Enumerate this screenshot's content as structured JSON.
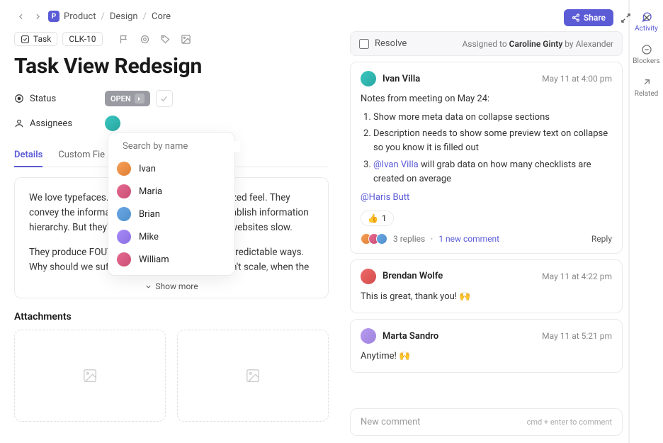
{
  "header": {
    "product_icon_letter": "P",
    "crumbs": [
      "Product",
      "Design",
      "Core"
    ],
    "share_label": "Share"
  },
  "task": {
    "type_label": "Task",
    "id": "CLK-10",
    "title": "Task View Redesign",
    "status_label": "Status",
    "status_value": "OPEN",
    "assignees_label": "Assignees"
  },
  "tabs": [
    "Details",
    "Custom Fie"
  ],
  "description": {
    "p1": "We love typefaces. They give our sites personalized feel. They convey the information and tell a story. They establish information hierarchy. But they're also messy and make our websites slow.",
    "p2": "They produce FOUT and FOIT. They render in unpredictable ways. Why should we suffer from this chaos that doesn't scale, when the",
    "show_more": "Show more"
  },
  "attachments_label": "Attachments",
  "assignee_search": {
    "placeholder": "Search by name",
    "options": [
      "Ivan",
      "Maria",
      "Brian",
      "Mike",
      "William"
    ]
  },
  "resolve": {
    "label": "Resolve",
    "assigned_prefix": "Assigned to ",
    "assignee": "Caroline Ginty",
    "by": " by Alexander"
  },
  "comments": [
    {
      "author": "Ivan Villa",
      "time": "May 11 at 4:00 pm",
      "intro": "Notes from meeting on May 24:",
      "points": [
        "Show more meta data on collapse sections",
        "Description needs to show some preview text on collapse so you know it is filled out",
        {
          "mention": "@Ivan Villa",
          "rest": " will grab data on how many checklists are created on average"
        }
      ],
      "trailing_mention": "@Haris Butt",
      "reaction_emoji": "👍",
      "reaction_count": "1",
      "replies": "3 replies",
      "new_comment": "1 new comment",
      "reply_label": "Reply"
    },
    {
      "author": "Brendan Wolfe",
      "time": "May 11 at 4:22 pm",
      "text": "This is great, thank you! 🙌"
    },
    {
      "author": "Marta Sandro",
      "time": "May 11 at 5:21 pm",
      "text": "Anytime! 🙌"
    }
  ],
  "composer": {
    "placeholder": "New comment",
    "hint": "cmd + enter to comment"
  },
  "rail": [
    {
      "label": "Activity"
    },
    {
      "label": "Blockers"
    },
    {
      "label": "Related"
    }
  ]
}
